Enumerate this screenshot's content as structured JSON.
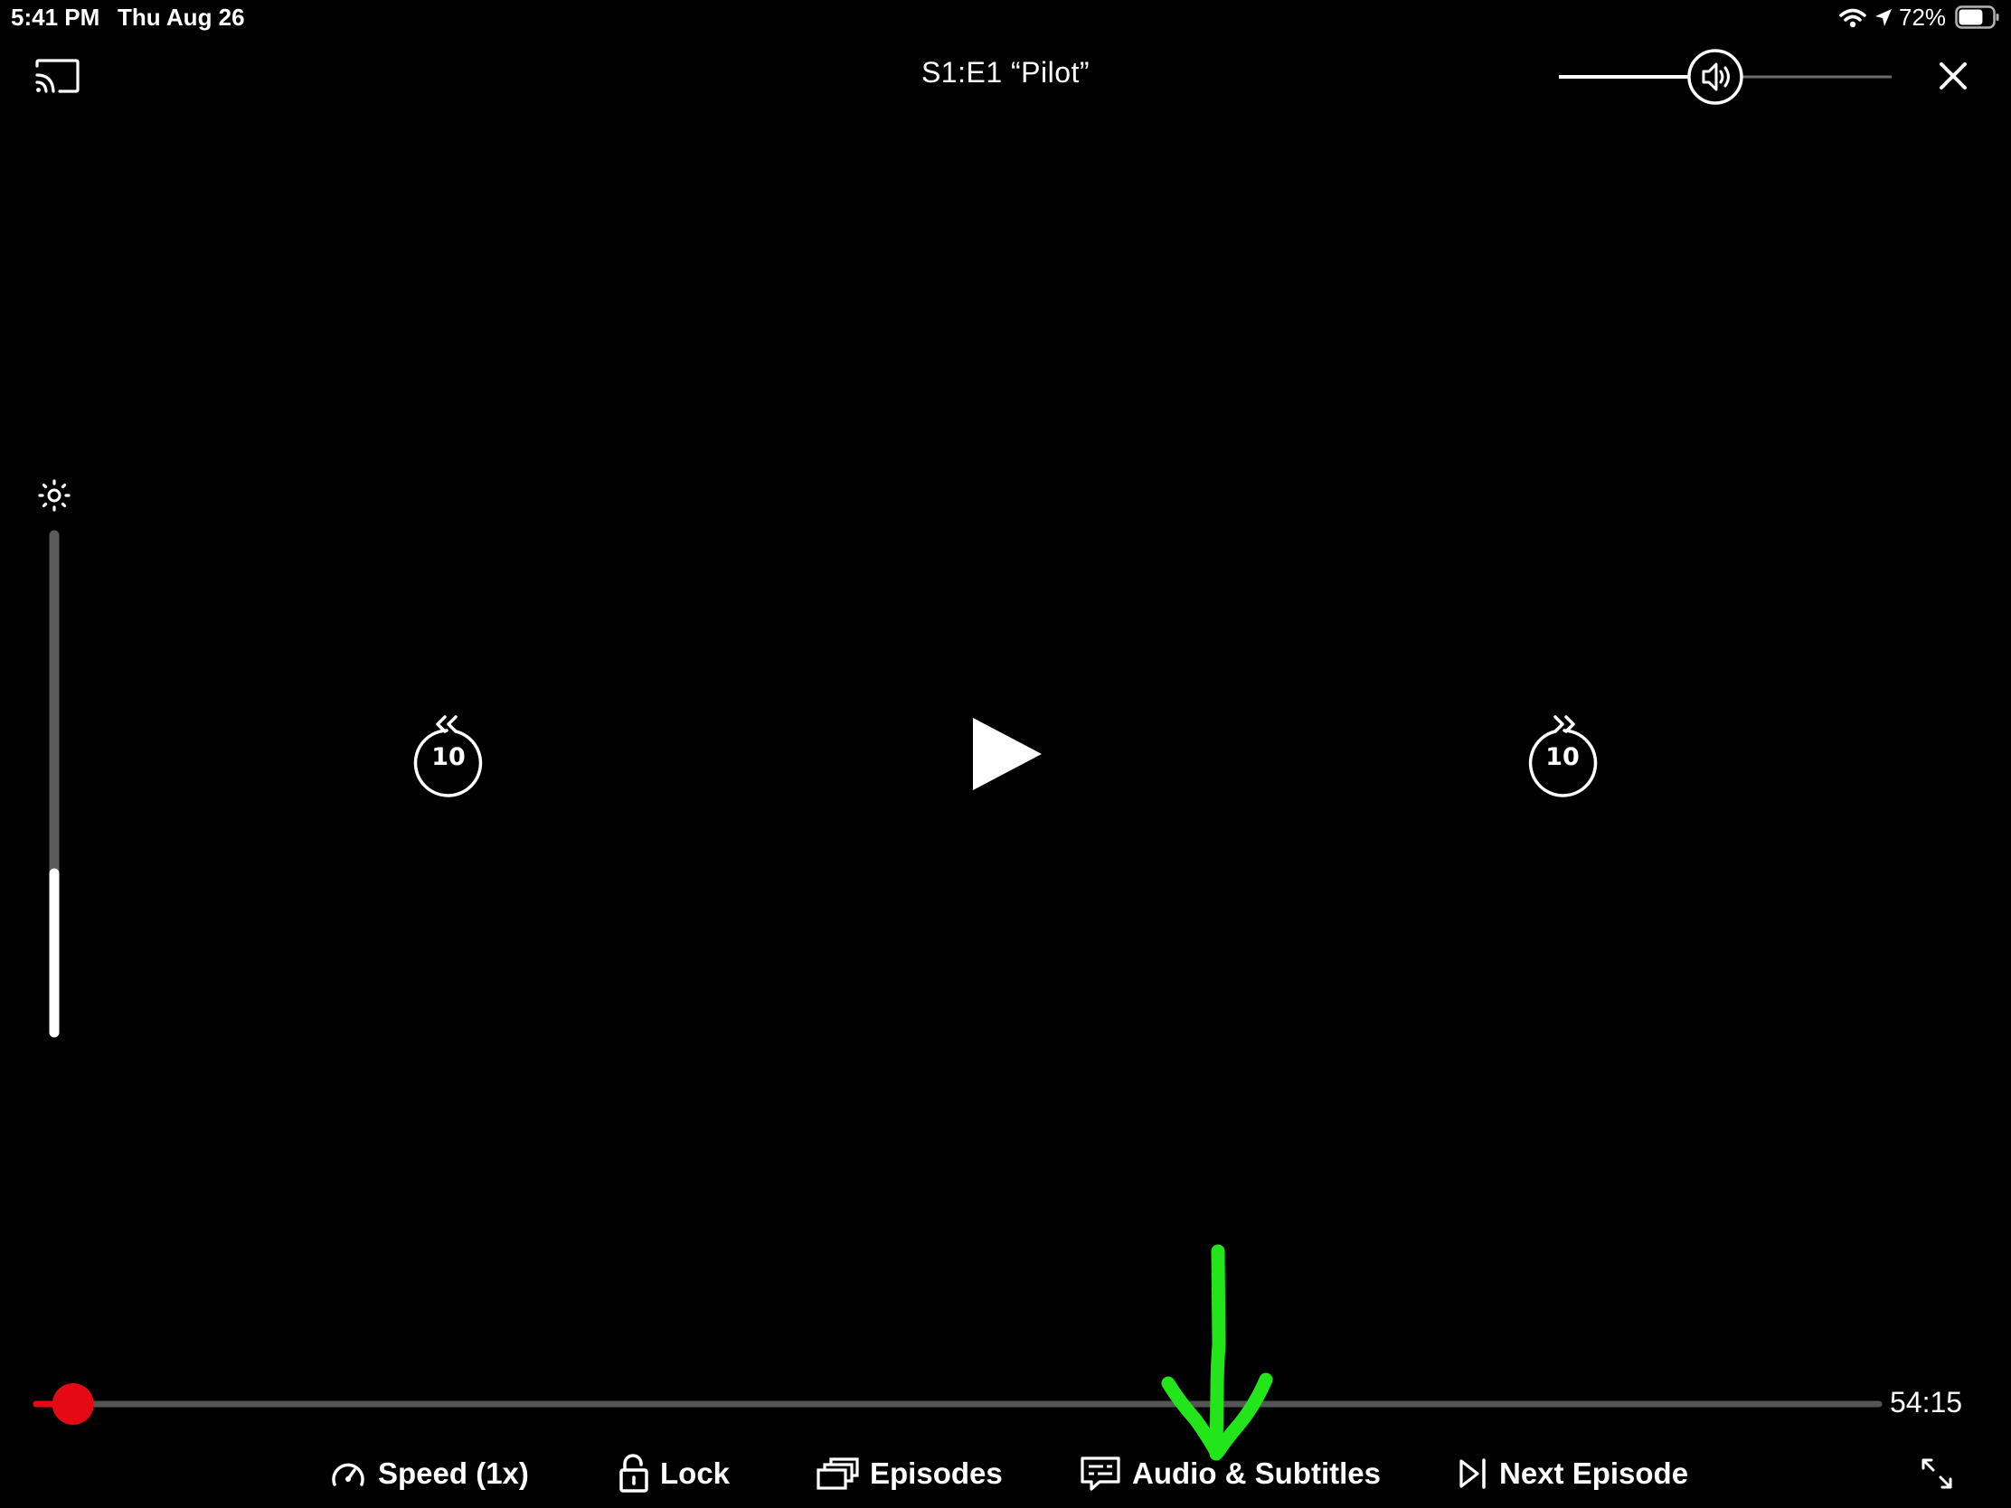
{
  "status_bar": {
    "time": "5:41 PM",
    "date": "Thu Aug 26",
    "battery_percent": "72%",
    "battery_level": 0.72
  },
  "header": {
    "episode_title": "S1:E1 “Pilot”",
    "volume_level": 0.47
  },
  "brightness": {
    "level": 0.32
  },
  "playback": {
    "rewind_seconds": "10",
    "forward_seconds": "10",
    "time_remaining": "54:15",
    "progress": 0.02
  },
  "controls": {
    "speed_label": "Speed (1x)",
    "lock_label": "Lock",
    "episodes_label": "Episodes",
    "audio_subtitles_label": "Audio & Subtitles",
    "next_episode_label": "Next Episode"
  },
  "annotation": {
    "arrow_color": "#22e61a"
  },
  "colors": {
    "progress_accent": "#e50914",
    "background": "#000000"
  }
}
